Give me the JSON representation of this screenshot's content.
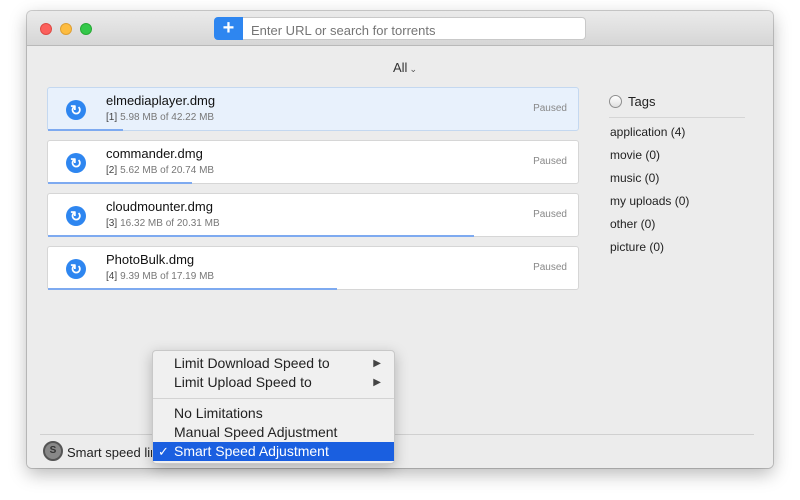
{
  "toolbar": {
    "add_label": "+",
    "search_placeholder": "Enter URL or search for torrents"
  },
  "filter": {
    "label": "All",
    "chevron_icon": "chevron-down-icon"
  },
  "torrents": [
    {
      "index": "[1]",
      "name": "elmediaplayer.dmg",
      "size": "5.98 MB of 42.22 MB",
      "status": "Paused",
      "progress": 0.142,
      "selected": true
    },
    {
      "index": "[2]",
      "name": "commander.dmg",
      "size": "5.62 MB of 20.74 MB",
      "status": "Paused",
      "progress": 0.271
    },
    {
      "index": "[3]",
      "name": "cloudmounter.dmg",
      "size": "16.32 MB of 20.31 MB",
      "status": "Paused",
      "progress": 0.804
    },
    {
      "index": "[4]",
      "name": "PhotoBulk.dmg",
      "size": "9.39 MB of 17.19 MB",
      "status": "Paused",
      "progress": 0.546
    }
  ],
  "tags": {
    "title": "Tags",
    "items": [
      "application (4)",
      "movie (0)",
      "music (0)",
      "my uploads (0)",
      "other (0)",
      "picture (0)"
    ]
  },
  "status": {
    "label": "Smart speed limits",
    "icon_letter": "S"
  },
  "context_menu": {
    "items": [
      {
        "label": "Limit Download Speed to",
        "submenu": true
      },
      {
        "label": "Limit Upload Speed to",
        "submenu": true
      },
      {
        "label": "No Limitations"
      },
      {
        "label": "Manual Speed Adjustment"
      },
      {
        "label": "Smart Speed Adjustment",
        "checked": true
      }
    ],
    "submenu_arrow": "▶",
    "check_mark": "✓"
  },
  "colors": {
    "accent": "#2e86f0",
    "progress": "#7eaaf0",
    "menu_highlight": "#1a5fe0"
  }
}
